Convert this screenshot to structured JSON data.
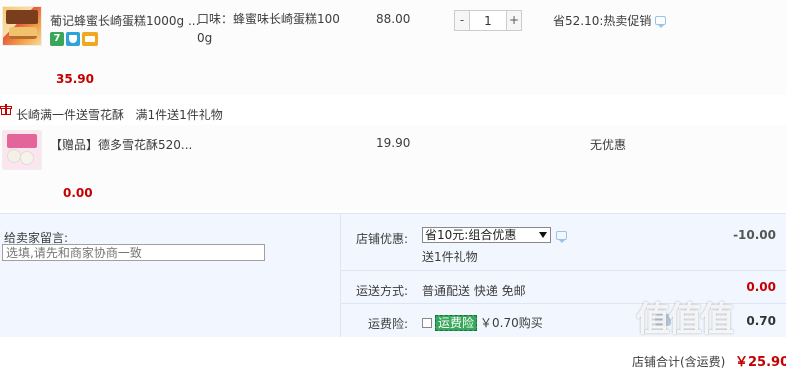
{
  "item1": {
    "title": "葡记蜂蜜长崎蛋糕1000g ...",
    "attr_line1": "口味：蜂蜜味长崎蛋糕100",
    "attr_line2": "0g",
    "unit_price": "88.00",
    "quantity": "1",
    "qty_minus": "-",
    "qty_plus": "+",
    "saving": "省52.10:热卖促销",
    "badges": [
      "7",
      "shield-icon",
      "card-icon"
    ],
    "subtotal": "35.90"
  },
  "promo": {
    "text": "长崎满一件送雪花酥   满1件送1件礼物"
  },
  "item2": {
    "title": "【赠品】德多雪花酥520...",
    "unit_price": "19.90",
    "discount": "无优惠",
    "subtotal": "0.00"
  },
  "message": {
    "label": "给卖家留言:",
    "placeholder": "选填,请先和商家协商一致"
  },
  "shop_discount": {
    "label": "店铺优惠:",
    "selected": "省10元:组合优惠",
    "gift_note": "送1件礼物",
    "amount": "-10.00"
  },
  "shipping": {
    "label": "运送方式:",
    "method": "普通配送 快递 免邮",
    "amount": "0.00"
  },
  "insurance": {
    "label": "运费险:",
    "tag": "运费险",
    "price": "￥0.70购买",
    "amount": "0.70"
  },
  "total": {
    "label": "店铺合计(含运费)",
    "value": "￥25.90"
  },
  "watermark": "值值值",
  "colors": {
    "price_red": "#c40000",
    "panel_bg": "#f2f7ff",
    "ins_green": "#37a85b"
  }
}
